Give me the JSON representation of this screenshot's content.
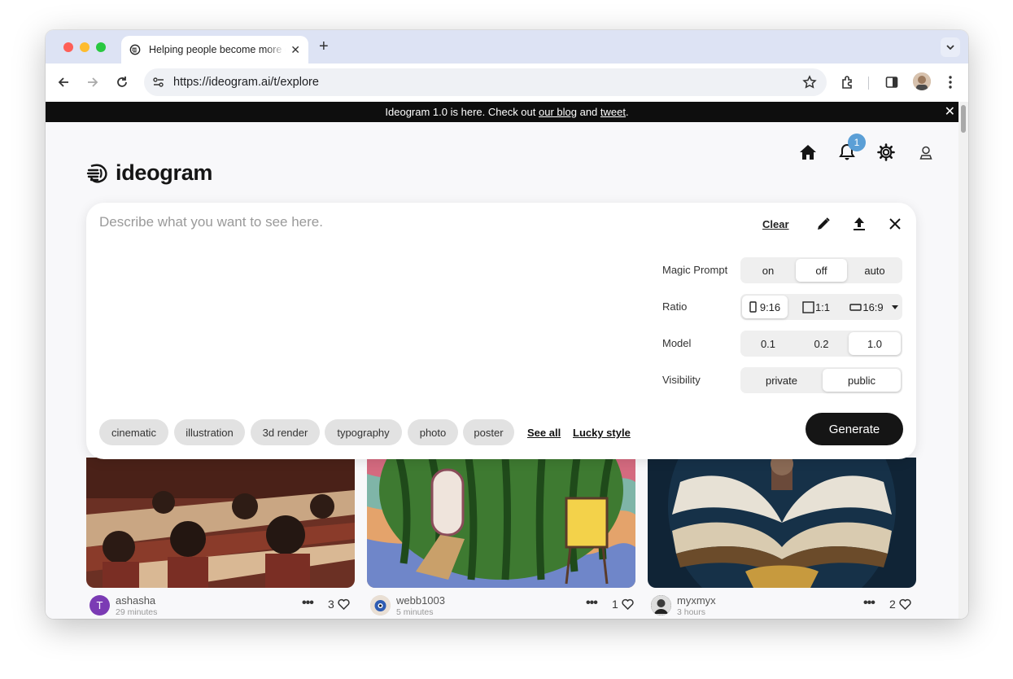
{
  "browser": {
    "tab_title": "Helping people become more creative",
    "url": "https://ideogram.ai/t/explore"
  },
  "banner": {
    "text_prefix": "Ideogram 1.0 is here. Check out ",
    "blog_link": "our blog",
    "text_middle": " and ",
    "tweet_link": "tweet",
    "text_suffix": "."
  },
  "header": {
    "logo_text": "ideogram",
    "notification_count": "1"
  },
  "prompt": {
    "placeholder": "Describe what you want to see here.",
    "clear_label": "Clear",
    "options": {
      "magic_prompt": {
        "label": "Magic Prompt",
        "values": [
          "on",
          "off",
          "auto"
        ],
        "selected": "off"
      },
      "ratio": {
        "label": "Ratio",
        "values": [
          "9:16",
          "1:1",
          "16:9"
        ],
        "selected": "9:16"
      },
      "model": {
        "label": "Model",
        "values": [
          "0.1",
          "0.2",
          "1.0"
        ],
        "selected": "1.0"
      },
      "visibility": {
        "label": "Visibility",
        "values": [
          "private",
          "public"
        ],
        "selected": "public"
      }
    },
    "style_chips": [
      "cinematic",
      "illustration",
      "3d render",
      "typography",
      "photo",
      "poster"
    ],
    "see_all": "See all",
    "lucky_style": "Lucky style",
    "generate_label": "Generate"
  },
  "gallery": [
    {
      "username": "ashasha",
      "time": "29 minutes",
      "likes": "3",
      "avatar_letter": "T"
    },
    {
      "username": "webb1003",
      "time": "5 minutes",
      "likes": "1"
    },
    {
      "username": "myxmyx",
      "time": "3 hours",
      "likes": "2"
    }
  ]
}
